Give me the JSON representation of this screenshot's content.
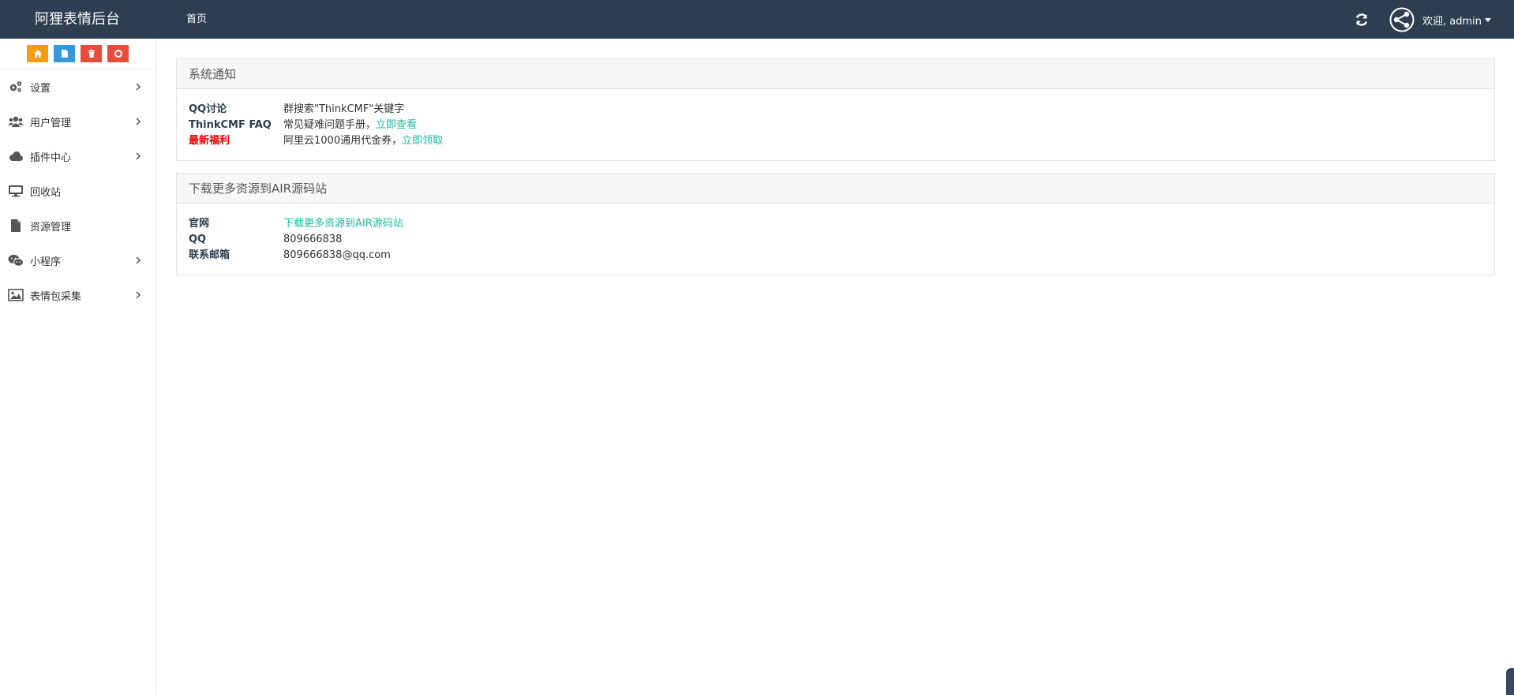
{
  "topbar": {
    "brand": "阿狸表情后台",
    "nav_home": "首页",
    "welcome": "欢迎, admin"
  },
  "sidebar": {
    "shortcuts": [
      {
        "icon": "home-icon",
        "color": "#f39c12"
      },
      {
        "icon": "document-icon",
        "color": "#3498db"
      },
      {
        "icon": "trash-icon",
        "color": "#e74c3c"
      },
      {
        "icon": "recycle-icon",
        "color": "#e74c3c"
      }
    ],
    "items": [
      {
        "label": "设置",
        "icon": "gears-icon",
        "has_children": true
      },
      {
        "label": "用户管理",
        "icon": "users-icon",
        "has_children": true
      },
      {
        "label": "插件中心",
        "icon": "cloud-icon",
        "has_children": true
      },
      {
        "label": "回收站",
        "icon": "monitor-icon",
        "has_children": false
      },
      {
        "label": "资源管理",
        "icon": "file-icon",
        "has_children": false
      },
      {
        "label": "小程序",
        "icon": "wechat-icon",
        "has_children": true
      },
      {
        "label": "表情包采集",
        "icon": "image-icon",
        "has_children": true
      }
    ]
  },
  "notice": {
    "title": "系统通知",
    "rows": [
      {
        "key": "QQ讨论",
        "value": "群搜索\"ThinkCMF\"关键字",
        "link": ""
      },
      {
        "key": "ThinkCMF FAQ",
        "value": "常见疑难问题手册，",
        "link": "立即查看"
      },
      {
        "key": "最新福利",
        "value": "阿里云1000通用代金券，",
        "link": "立即领取"
      }
    ]
  },
  "resources": {
    "title": "下载更多资源到AIR源码站",
    "rows": [
      {
        "key": "官网",
        "value": "",
        "link": "下载更多资源到AIR源码站"
      },
      {
        "key": "QQ",
        "value": "809666838",
        "link": ""
      },
      {
        "key": "联系邮箱",
        "value": "809666838@qq.com",
        "link": ""
      }
    ]
  },
  "colors": {
    "topbar": "#2c3e50",
    "link": "#18bc9c",
    "highlight_key": "#e70000"
  }
}
